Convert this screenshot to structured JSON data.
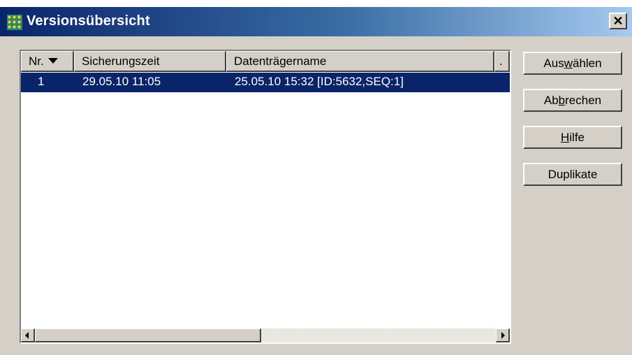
{
  "window": {
    "title": "Versionsübersicht",
    "close_symbol": "✕"
  },
  "list": {
    "columns": [
      {
        "label": "Nr."
      },
      {
        "label": "Sicherungszeit"
      },
      {
        "label": "Datenträgername"
      },
      {
        "label": "."
      }
    ],
    "sort_column": "Nr.",
    "rows": [
      {
        "nr": "1",
        "time": "29.05.10 11:05",
        "name": "25.05.10 15:32 [ID:5632,SEQ:1]",
        "selected": true
      }
    ]
  },
  "buttons": [
    {
      "pre": "Aus",
      "key": "w",
      "post": "ählen"
    },
    {
      "pre": "Ab",
      "key": "b",
      "post": "rechen"
    },
    {
      "pre": "",
      "key": "H",
      "post": "ilfe"
    },
    {
      "pre": "Duplikate",
      "key": "",
      "post": ""
    }
  ],
  "colors": {
    "selection": "#0a246a",
    "face": "#d4d0c8"
  },
  "icons": [
    "app-icon",
    "sort-descending-icon",
    "close-icon",
    "scroll-left-icon",
    "scroll-right-icon"
  ]
}
